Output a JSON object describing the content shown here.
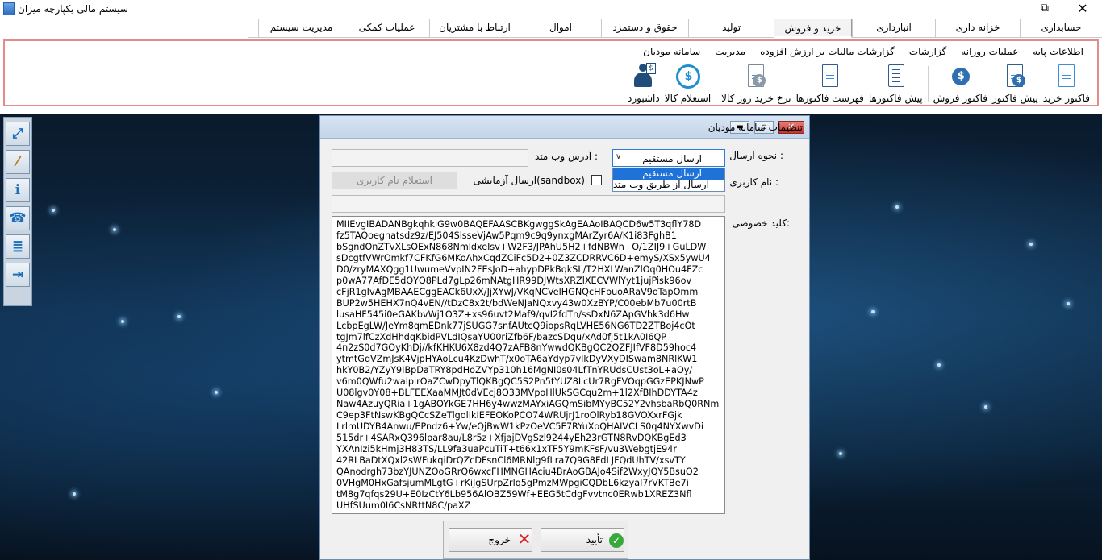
{
  "window": {
    "title": "سیستم مالی یکپارچه میزان",
    "restore_glyph": "⧉",
    "close_glyph": "✕"
  },
  "tabs": [
    "حسابداری",
    "خزانه داری",
    "انبارداری",
    "خرید و فروش",
    "تولید",
    "حقوق و دستمزد",
    "اموال",
    "ارتباط با مشتریان",
    "عملیات کمکی",
    "مدیریت سیستم"
  ],
  "active_tab": "خرید و فروش",
  "ribbon": {
    "subtabs": [
      "اطلاعات پایه",
      "عملیات روزانه",
      "گزارشات",
      "گزارشات مالیات بر ارزش افزوده",
      "مدیریت",
      "سامانه مودیان"
    ],
    "tools": [
      {
        "label": "فاکتور خرید",
        "icon": "document-icon"
      },
      {
        "label": "پیش فاکتور",
        "icon": "coin-document-icon"
      },
      {
        "label": "فاکتور فروش",
        "icon": "fast-coin-icon"
      },
      {
        "label": "پیش فاکتورها",
        "icon": "checklist-icon"
      },
      {
        "label": "فهرست فاکتورها",
        "icon": "invoice-list-icon"
      },
      {
        "label": "نرخ خرید روز کالا",
        "icon": "price-rate-icon"
      },
      {
        "label": "استعلام کالا",
        "icon": "inquiry-icon"
      },
      {
        "label": "داشبورد",
        "icon": "dashboard-user-icon"
      }
    ]
  },
  "dialog": {
    "title": "تنظیمات سامانه مودیان",
    "send_method_label": "نحوه ارسال :",
    "send_method_value": "ارسال مستقیم",
    "send_method_options": [
      "ارسال مستقیم",
      "ارسال از طریق وب متد"
    ],
    "webmethod_address_label": "آدرس وب متد :",
    "webmethod_address_value": "",
    "username_label": "نام کاربری :",
    "sandbox_label": "ارسال آزمایشی(sandbox)",
    "sandbox_checked": false,
    "username_inquiry_button": "استعلام نام کاربری",
    "username_value": "",
    "private_key_label": "کلید خصوصی:",
    "private_key": "MIIEvgIBADANBgkqhkiG9w0BAQEFAASCBKgwggSkAgEAAoIBAQCD6w5T3qflY78D\nfz5TAQoegnatsdz9z/EJ504SlsseVjAw5Pqm9c9q9ynxgMArZyr6A/K1i83FghB1\nbSgndOnZTvXLsOExN868NmldxeIsv+W2F3/JPAhU5H2+fdNBWn+O/1ZIJ9+GuLDW\nsDcgtfVWrOmkf7CFKfG6MKoAhxCqdZCiFc5D2+0Z3ZCDRRVC6D+emyS/XSx5ywU4\nD0/zryMAXQgg1UwumeVvpIN2FEsJoD+ahypDPkBqkSL/T2HXLWanZlOq0HOu4FZc\np0wA77AfDE5dQYQ8PLd7gLp26mNAtgHR99DJWtsXRZlXECVWlYyt1jujPisk96ov\ncFjR1gIvAgMBAAECggEACk6UxX/JjXYwJ/VKqNCVelHGNQcHFbuoARaV9oTapOmm\nBUP2w5HEHX7nQ4vEN//tDzC8x2t/bdWeNJaNQxvy43w0XzBYP/C00ebMb7u00rtB\nlusaHF545i0eGAKbvWj1O3Z+xs96uvt2Maf9/qvI2fdTn/ssDxN6ZApGVhk3d6Hw\nLcbpEgLW/JeYm8qmEDnk77jSUGG7snfAUtcQ9iopsRqLVHE56NG6TD2ZTBoj4cOt\ntgJm7lfCzXdHhdqKbidPVLdIQsaYU00riZfb6F/bazcSDqu/xAd0fj5t1kA0I6QP\n4n2zS0d7GOyKhDj//kfKHKU6X8zd4Q7zAFB8nYwwdQKBgQC2QZFJIfVF8D59hoc4\nytmtGqVZmJsK4VjpHYAoLcu4KzDwhT/x0oTA6aYdyp7vlkDyVXyDISwam8NRlKW1\nhkY0B2/YZyY9IBpDaTRY8pdHoZVYp310h16MgNI0s04LfTnYRUdsCUst3oL+aOy/\nv6m0QWfu2walpirOaZCwDpyTlQKBgQC5S2Pn5tYUZ8LcUr7RgFVOqpGGzEPKJNwP\nU08lgv0Y08+BLFEEXaaMMJt0dVEcj8Q33MVpoHlUkSGCqu2m+1l2XfBIhDDYTA4z\nNaw4AzuyQRia+1gABOYkGE7HH6y4wwzMAYxiAGQmSibMYyBC52Y2vhsbaRbQ0RNm\nC9ep3FtNswKBgQCcSZeTlgolIkIEFEOKoPCO74WRUjrJ1roOlRyb18GVOXxrFGjk\nLrlmUDYB4Anwu/EPndz6+Yw/eQjBwW1kPzOeVC5F7RYuXoQHAIVCLS0q4NYXwvDi\n515dr+4SARxQ396lpar8au/L8r5z+XfjajDVgSzl9244yEh23rGTN8RvDQKBgEd3\nYXAnIzi5kHmj3H83TS/LL9fa3uaPcuTiT+t66x1xTF5Y9mKFsF/vu3WebgtjE94r\n42RLBaDtXQxl2sWFukqiDrQZcDFsnCl6MRNlg9fLra7Q9G8FdLJFQdUhTV/xsvTY\nQAnodrgh73bzYJUNZOoGRrQ6wxcFHMNGHAciu4BrAoGBAJo4Sif2WxyJQY5BsuO2\n0VHgM0HxGafsjumMLgtG+rKiJgSUrpZrlq5gPmzMWpgiCQDbL6kzyaI7rVKTBe7i\ntM8g7qfqs29U+E0IzCtY6Lb956AlOBZ59Wf+EEG5tCdgFvvtnc0ERwb1XREZ3Nfl\nUHfSUum0I6CsNRttN8C/paXZ",
    "confirm_button": "تأیید",
    "exit_button": "خروج"
  }
}
